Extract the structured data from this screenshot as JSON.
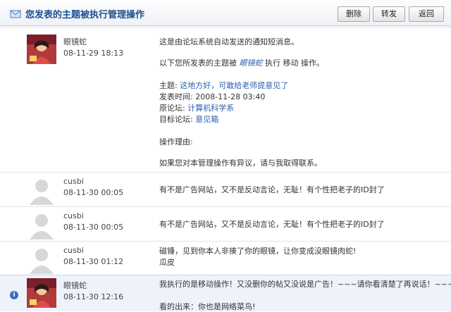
{
  "header": {
    "title": "您发表的主题被执行管理操作",
    "buttons": {
      "delete": "删除",
      "forward": "转发",
      "back": "返回"
    }
  },
  "messages": [
    {
      "user": "眼镜蛇",
      "time": "08-11-29 18:13",
      "lines": {
        "l1": "这是由论坛系统自动发送的通知短消息。",
        "l2_prefix": "以下您所发表的主题被",
        "l2_actor": "眼镜蛇",
        "l2_mid": "执行",
        "l2_action": "移动",
        "l2_suffix": "操作。",
        "subject_label": "主题:",
        "subject_value": "这地方好，可敢给老师提意见了",
        "posttime_label": "发表时间:",
        "posttime_value": "2008-11-28 03:40",
        "origin_label": "原论坛:",
        "origin_value": "计算机科学系",
        "target_label": "目标论坛:",
        "target_value": "意见箱",
        "reason_label": "操作理由:",
        "footer": "如果您对本管理操作有异议，请与我取得联系。"
      }
    },
    {
      "user": "cusbi",
      "time": "08-11-30 00:05",
      "text": "有不是广告网站，又不是反动言论，无耻！有个性把老子的ID封了"
    },
    {
      "user": "cusbi",
      "time": "08-11-30 00:05",
      "text": "有不是广告网站，又不是反动言论，无耻！有个性把老子的ID封了"
    },
    {
      "user": "cusbi",
      "time": "08-11-30 01:12",
      "text": "磁锤，见到你本人非揍了你的眼镜，让你变成没眼镜肉蛇!",
      "text2": "瓜皮"
    },
    {
      "user": "眼镜蛇",
      "time": "08-11-30 12:16",
      "text": "我执行的是移动操作！又没删你的帖又没说是广告！~~~请你看清楚了再说话！~~~",
      "text2": "看的出来：你也是网络菜鸟!"
    }
  ]
}
